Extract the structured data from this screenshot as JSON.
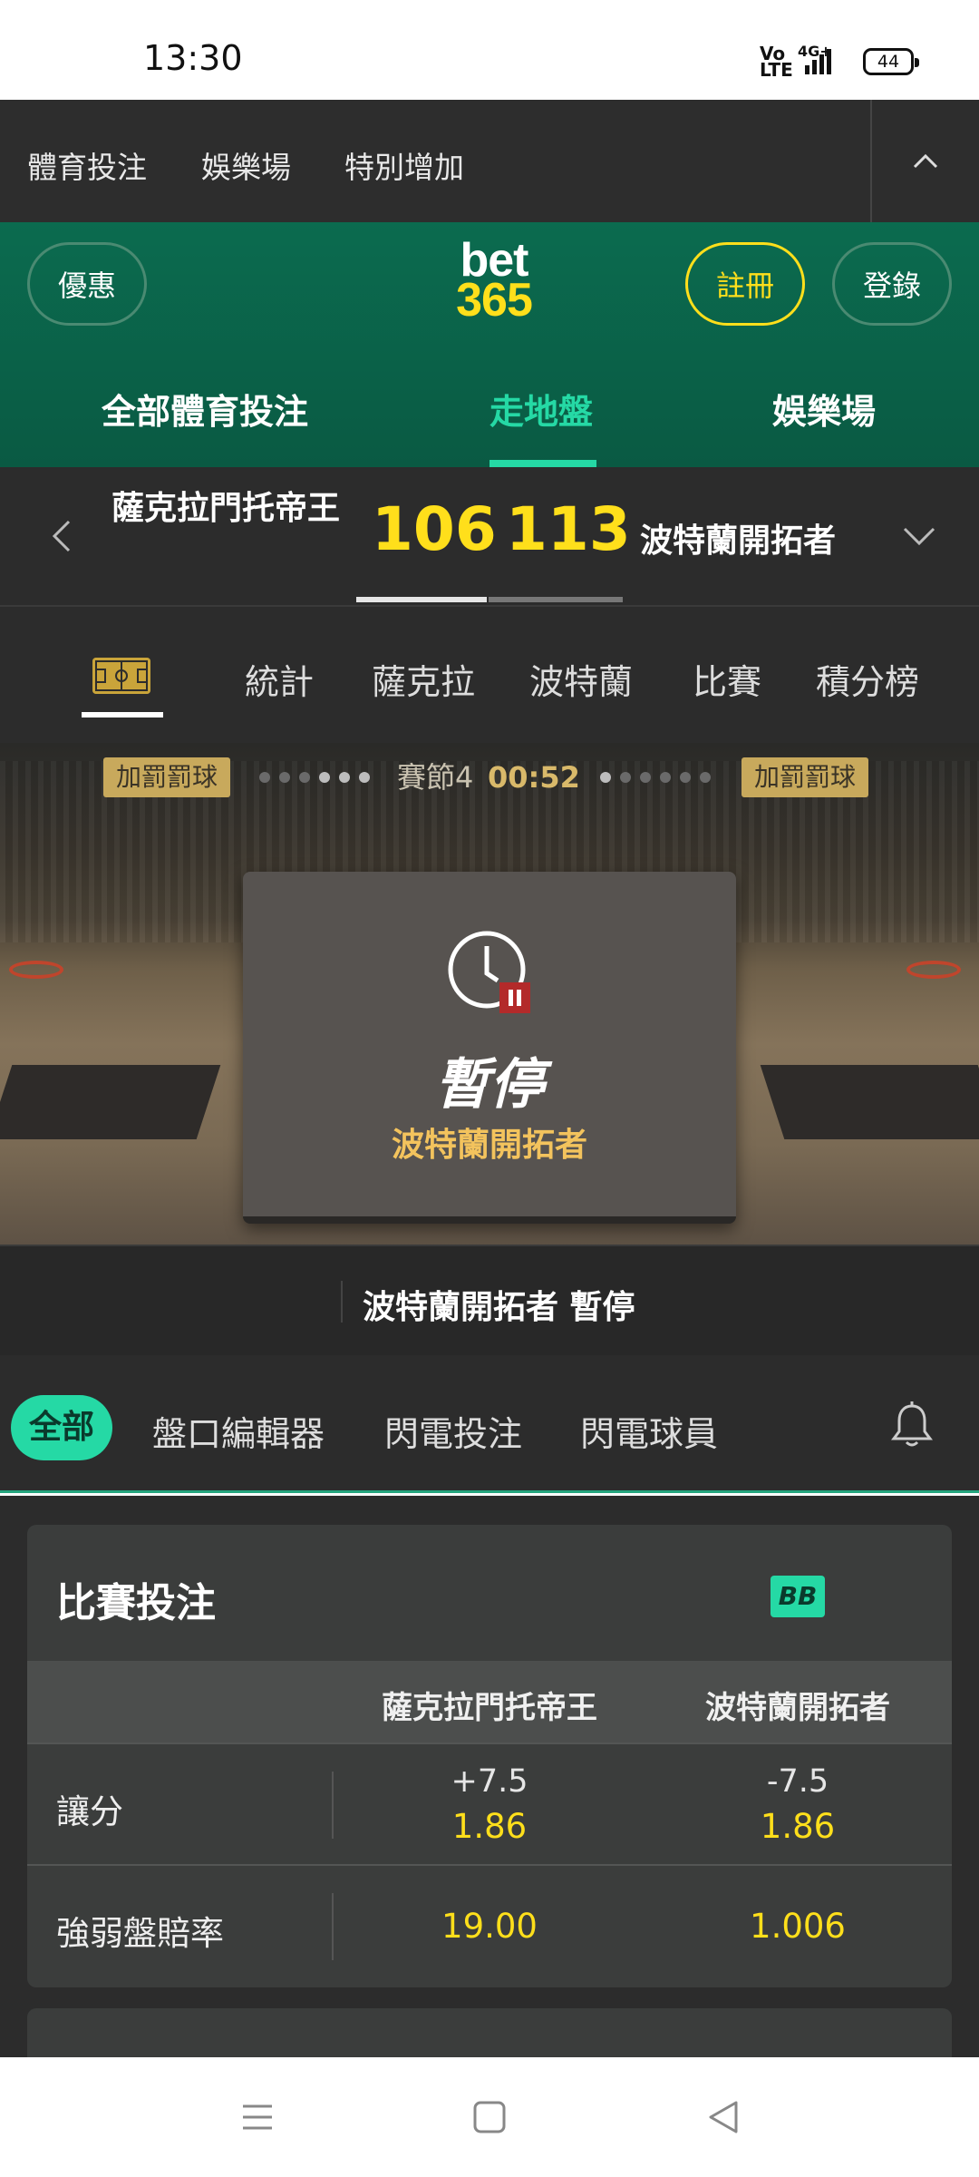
{
  "status_bar": {
    "time": "13:30",
    "network": "4G+",
    "volte": "Vo LTE",
    "battery": "44"
  },
  "top_nav": {
    "items": [
      "體育投注",
      "娛樂場",
      "特別增加"
    ]
  },
  "header": {
    "promo_label": "優惠",
    "logo_line1": "bet",
    "logo_line2": "365",
    "register_label": "註冊",
    "login_label": "登錄",
    "tabs": [
      "全部體育投注",
      "走地盤",
      "娛樂場"
    ],
    "active_tab": "走地盤",
    "accent_color": "#25d9a5",
    "brand_color": "#0b6b4f",
    "highlight_color": "#ffdf1b"
  },
  "scoreboard": {
    "home_team": "薩克拉門托帝王",
    "home_score": "106",
    "away_score": "113",
    "away_team": "波特蘭開拓者"
  },
  "sub_tabs": [
    "統計",
    "薩克拉",
    "波特蘭",
    "比賽",
    "積分榜"
  ],
  "court": {
    "penalty_left": "加罰罰球",
    "penalty_right": "加罰罰球",
    "period": "賽節4",
    "clock": "00:52",
    "pause_title": "暫停",
    "pause_team": "波特蘭開拓者",
    "event_text": "波特蘭開拓者 暫停"
  },
  "filters": {
    "all": "全部",
    "items": [
      "盤口編輯器",
      "閃電投注",
      "閃電球員"
    ]
  },
  "market": {
    "title": "比賽投注",
    "badge": "BB",
    "col_home": "薩克拉門托帝王",
    "col_away": "波特蘭開拓者",
    "rows": [
      {
        "label": "讓分",
        "home_line": "+7.5",
        "home_odds": "1.86",
        "away_line": "-7.5",
        "away_odds": "1.86"
      },
      {
        "label": "強弱盤賠率",
        "home_odds": "19.00",
        "away_odds": "1.006"
      }
    ]
  }
}
